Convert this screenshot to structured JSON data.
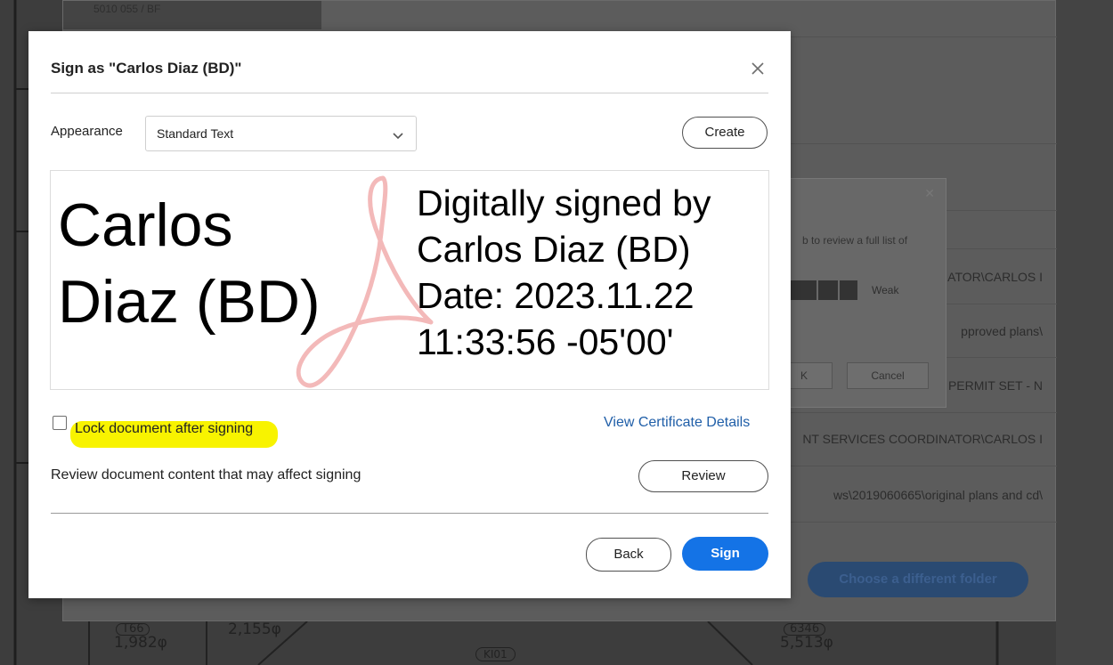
{
  "background": {
    "top_text": "5010 055 / BF",
    "sub_dialog": {
      "message": "b to review a full list of",
      "strength": "Weak",
      "ok_fragment": "K",
      "cancel": "Cancel"
    },
    "paths": [
      "ATOR\\CARLOS I",
      "pproved plans\\",
      "PERMIT SET - N",
      "NT SERVICES COORDINATOR\\CARLOS I",
      "ws\\2019060665\\original plans and cd\\"
    ],
    "choose_folder": "Choose a different folder",
    "drawing_labels": {
      "a_tag": "T66",
      "a_value": "1,982φ",
      "b_value": "2,155φ",
      "c_tag": "KI01",
      "d_tag": "6346",
      "d_value": "5,513φ"
    }
  },
  "dialog": {
    "title": "Sign as \"Carlos Diaz (BD)\"",
    "appearance_label": "Appearance",
    "appearance_value": "Standard Text",
    "create_label": "Create",
    "preview": {
      "name_line1": "Carlos",
      "name_line2": "Diaz (BD)",
      "detail_line1": "Digitally signed by",
      "detail_line2": "Carlos Diaz (BD)",
      "detail_line3": "Date: 2023.11.22",
      "detail_line4": "11:33:56 -05'00'"
    },
    "lock_label": "Lock document after signing",
    "lock_checked": false,
    "view_certificate": "View Certificate Details",
    "review_text": "Review document content that may affect signing",
    "review_label": "Review",
    "back_label": "Back",
    "sign_label": "Sign",
    "colors": {
      "primary": "#1473e6",
      "link": "#1f5ea8",
      "highlight": "#f8f300"
    }
  }
}
